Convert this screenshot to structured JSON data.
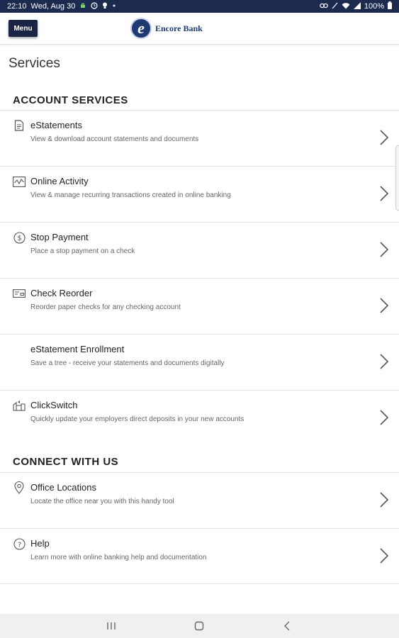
{
  "status_bar": {
    "time": "22:10",
    "date": "Wed, Aug 30",
    "battery": "100%",
    "left_icons": [
      "android-icon",
      "clock-icon",
      "bulb-icon",
      "dot-icon"
    ],
    "right_icons": [
      "link-icon",
      "mute-icon",
      "wifi-icon",
      "signal-icon",
      "battery-icon"
    ]
  },
  "header": {
    "menu_label": "Menu",
    "logo_letter": "e",
    "logo_text": "Encore Bank"
  },
  "page": {
    "title": "Services"
  },
  "sections": [
    {
      "heading": "ACCOUNT SERVICES",
      "items": [
        {
          "title": "eStatements",
          "description": "View & download account statements and documents",
          "icon": "document-icon"
        },
        {
          "title": "Online Activity",
          "description": "View & manage recurring transactions created in online banking",
          "icon": "activity-icon"
        },
        {
          "title": "Stop Payment",
          "description": "Place a stop payment on a check",
          "icon": "dollar-icon"
        },
        {
          "title": "Check Reorder",
          "description": "Reorder paper checks for any checking account",
          "icon": "check-icon"
        },
        {
          "title": "eStatement Enrollment",
          "description": "Save a tree - receive your statements and documents digitally",
          "icon": ""
        },
        {
          "title": "ClickSwitch",
          "description": "Quickly update your employers direct deposits in your new accounts",
          "icon": "switch-icon"
        }
      ]
    },
    {
      "heading": "CONNECT WITH US",
      "items": [
        {
          "title": "Office Locations",
          "description": "Locate the office near you with this handy tool",
          "icon": "location-pin-icon"
        },
        {
          "title": "Help",
          "description": "Learn more with online banking help and documentation",
          "icon": "question-icon"
        }
      ]
    }
  ],
  "nav_bar": {
    "buttons": [
      "recents-icon",
      "home-icon",
      "back-icon"
    ]
  },
  "colors": {
    "status_bar": "#1d2a4f",
    "menu_button": "#1b2444",
    "brand": "#1f3a72",
    "divider": "#e3e3e3",
    "nav_bar": "#f0f0f0"
  }
}
